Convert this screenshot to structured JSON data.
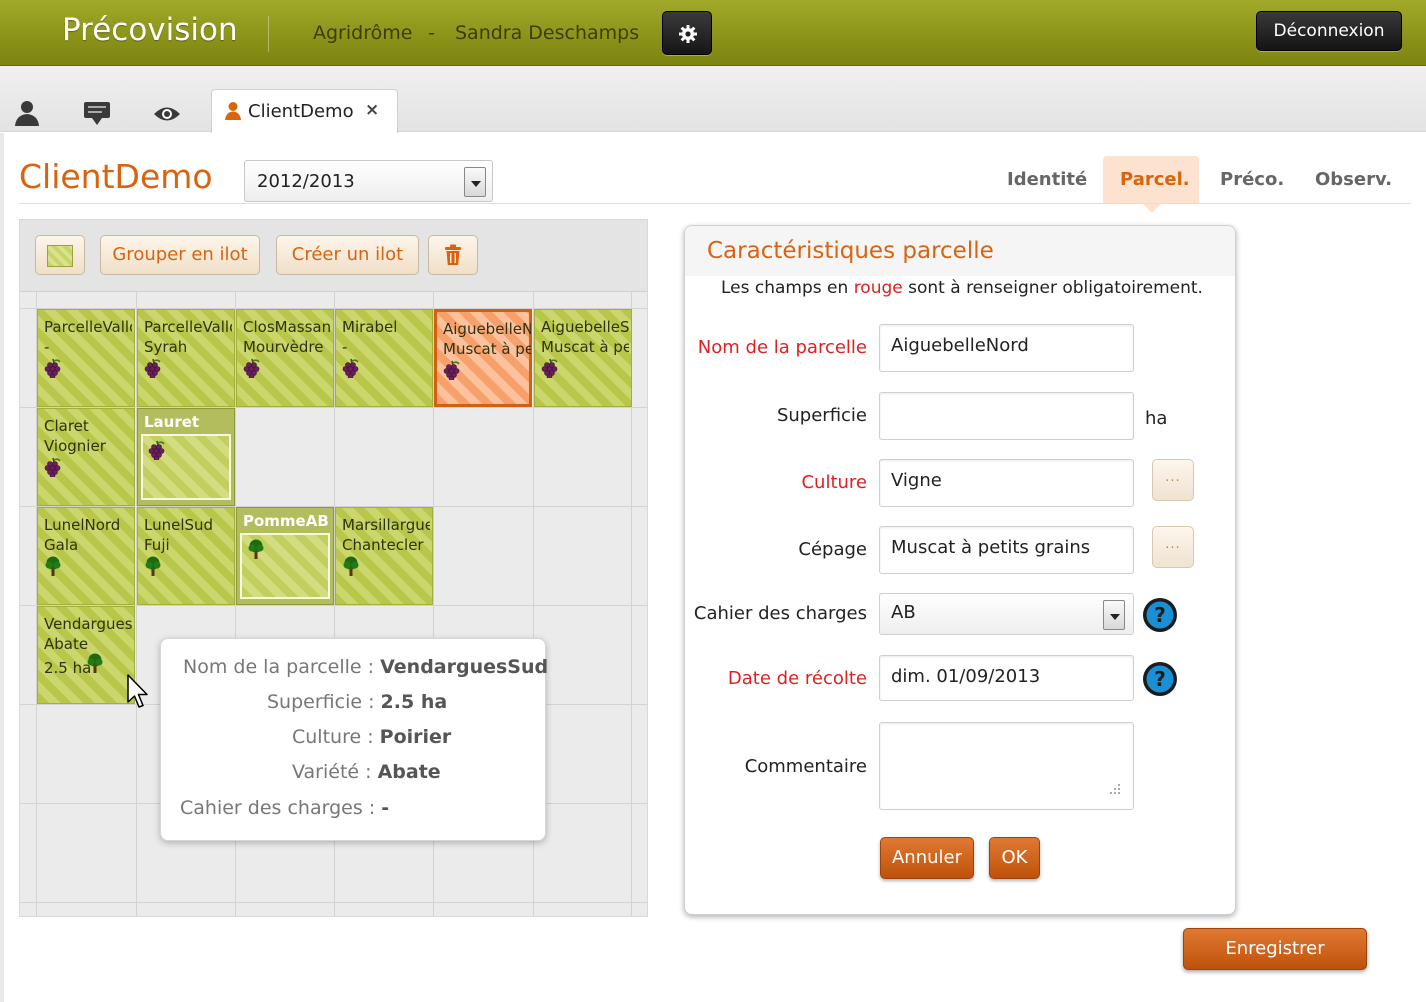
{
  "header": {
    "app_title": "Précovision",
    "org": "Agridrôme",
    "dash": "-",
    "user": "Sandra Deschamps",
    "settings_icon": "gear-icon",
    "logout_label": "Déconnexion"
  },
  "tabstrip": {
    "icons": [
      "person-icon",
      "comment-icon",
      "eye-icon"
    ],
    "client_tab_label": "ClientDemo",
    "client_tab_close": "×"
  },
  "page": {
    "title": "ClientDemo",
    "season": "2012/2013",
    "nav_tabs": [
      {
        "label": "Identité",
        "active": false
      },
      {
        "label": "Parcel.",
        "active": true
      },
      {
        "label": "Préco.",
        "active": false
      },
      {
        "label": "Observ.",
        "active": false
      }
    ]
  },
  "toolbar": {
    "group_label": "Grouper en ilot",
    "create_label": "Créer un ilot",
    "delete_icon": "trash-icon"
  },
  "parcels": [
    {
      "l1": "ParcelleVallon",
      "l2": "-",
      "icon": "grape"
    },
    {
      "l1": "ParcelleVallon",
      "l2": "Syrah",
      "icon": "grape"
    },
    {
      "l1": "ClosMassane",
      "l2": "Mourvèdre",
      "icon": "grape"
    },
    {
      "l1": "Mirabel",
      "l2": "-",
      "icon": "grape"
    },
    {
      "l1": "AiguebelleNord",
      "l2": "Muscat à petits grains",
      "icon": "grape",
      "selected": true
    },
    {
      "l1": "AiguebelleSud",
      "l2": "Muscat à petits grains",
      "icon": "grape"
    },
    {
      "l1": "Claret",
      "l2": "Viognier",
      "icon": "grape"
    },
    {
      "l1": "LunelNord",
      "l2": "Gala",
      "icon": "tree"
    },
    {
      "l1": "LunelSud",
      "l2": "Fuji",
      "icon": "tree"
    },
    {
      "l1": "Marsillargues",
      "l2": "Chantecler",
      "icon": "tree"
    },
    {
      "l1": "VendarguesSud",
      "l2": "Abate",
      "area": "2.5 ha",
      "icon": "tree"
    }
  ],
  "groups": [
    {
      "name": "Lauret",
      "icon": "grape"
    },
    {
      "name": "PommeAB",
      "icon": "tree"
    }
  ],
  "tooltip": {
    "rows": [
      {
        "label": "Nom de la parcelle :",
        "value": "VendarguesSud"
      },
      {
        "label": "Superficie :",
        "value": "2.5 ha"
      },
      {
        "label": "Culture :",
        "value": "Poirier"
      },
      {
        "label": "Variété :",
        "value": "Abate"
      },
      {
        "label": "Cahier des charges :",
        "value": "-"
      }
    ]
  },
  "form": {
    "title": "Caractéristiques parcelle",
    "note_before": "Les champs en",
    "note_red": "rouge",
    "note_after": "sont à renseigner obligatoirement.",
    "name_label": "Nom de la parcelle",
    "name_value": "AiguebelleNord",
    "area_label": "Superficie",
    "area_value": "",
    "area_unit": "ha",
    "culture_label": "Culture",
    "culture_value": "Vigne",
    "cepage_label": "Cépage",
    "cepage_value": "Muscat à petits grains",
    "cahier_label": "Cahier des charges",
    "cahier_value": "AB",
    "date_label": "Date de récolte",
    "date_value": "dim. 01/09/2013",
    "comment_label": "Commentaire",
    "comment_value": "",
    "dots": "...",
    "cancel_label": "Annuler",
    "ok_label": "OK"
  },
  "save_label": "Enregistrer",
  "colors": {
    "accent": "#d9630f",
    "topbar": "#8a9218",
    "required": "#e02020",
    "parcel": "#c7d36b",
    "selected": "#f7a06c"
  }
}
